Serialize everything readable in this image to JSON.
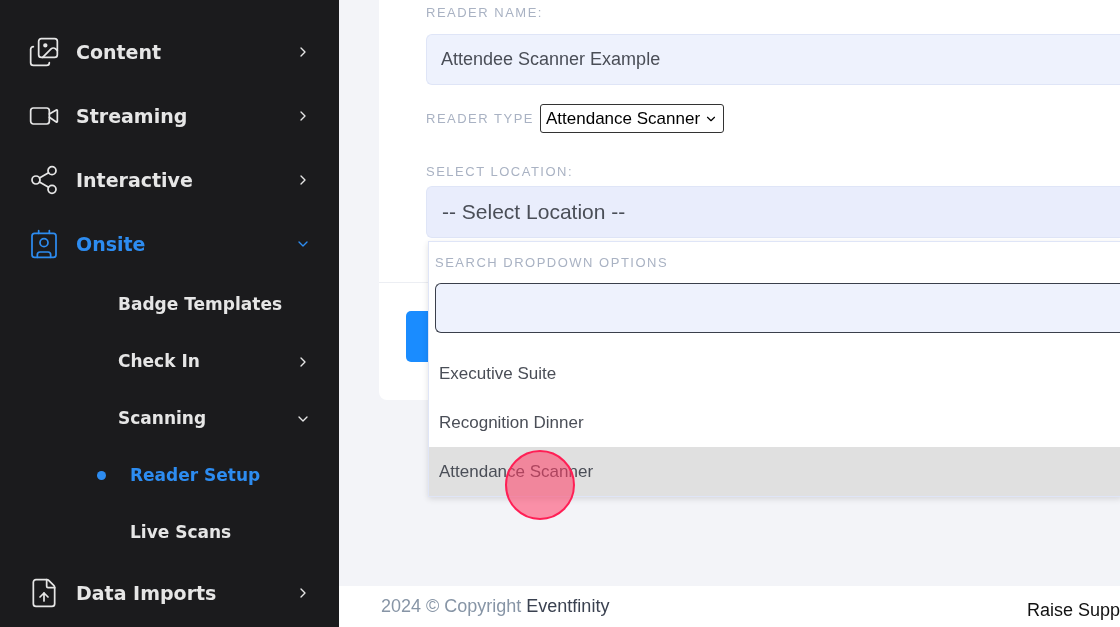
{
  "sidebar": {
    "items": [
      {
        "label": "Content",
        "selected": false,
        "expanded": false
      },
      {
        "label": "Streaming",
        "selected": false,
        "expanded": false
      },
      {
        "label": "Interactive",
        "selected": false,
        "expanded": false
      },
      {
        "label": "Onsite",
        "selected": true,
        "expanded": true,
        "children": [
          {
            "label": "Badge Templates",
            "selected": false,
            "expandable": false
          },
          {
            "label": "Check In",
            "selected": false,
            "expandable": true,
            "expanded": false
          },
          {
            "label": "Scanning",
            "selected": false,
            "expandable": true,
            "expanded": true,
            "children": [
              {
                "label": "Reader Setup",
                "selected": true
              },
              {
                "label": "Live Scans",
                "selected": false
              }
            ]
          }
        ]
      },
      {
        "label": "Data Imports",
        "selected": false,
        "expanded": false
      }
    ]
  },
  "form": {
    "reader_name": {
      "label": "READER NAME:",
      "value": "Attendee Scanner Example"
    },
    "reader_type": {
      "label": "READER TYPE",
      "value": "Attendance Scanner"
    },
    "location": {
      "label": "SELECT LOCATION:",
      "value": "-- Select Location --"
    }
  },
  "dropdown": {
    "search_label": "SEARCH DROPDOWN OPTIONS",
    "options": [
      {
        "label": "Executive Suite",
        "selected": false
      },
      {
        "label": "Recognition Dinner",
        "selected": false
      },
      {
        "label": "Attendance Scanner",
        "selected": true
      }
    ]
  },
  "footer": {
    "copyright": "2024 © Copyright",
    "brand": "Eventfinity",
    "link": "Raise Supp"
  }
}
